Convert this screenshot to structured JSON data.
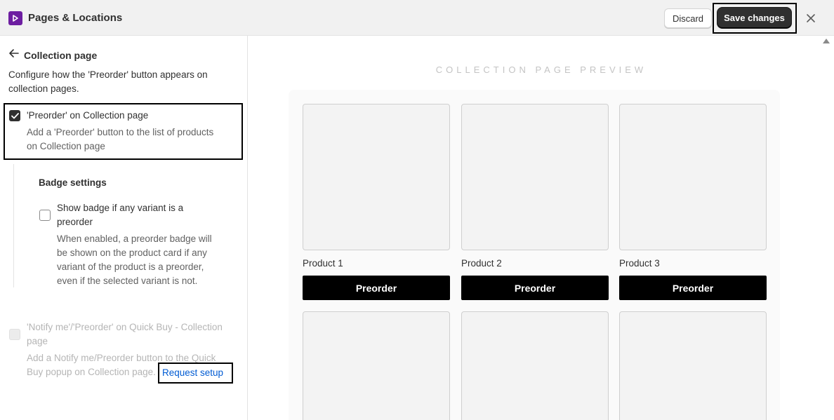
{
  "header": {
    "logo_icon": "app-logo-icon",
    "title": "Pages & Locations",
    "discard_label": "Discard",
    "save_label": "Save changes",
    "close_icon": "close-icon"
  },
  "sidebar": {
    "back_title": "Collection page",
    "description": "Configure how the 'Preorder' button appears on collection pages.",
    "option_preorder": {
      "checked": true,
      "label": "'Preorder' on Collection page",
      "help_line1": "Add a 'Preorder' button to the list of products",
      "help_line2": "on Collection page"
    },
    "badge_settings": {
      "heading": "Badge settings",
      "checked": false,
      "label_line1": "Show badge if any variant is a",
      "label_line2": "preorder",
      "help_line1": "When enabled, a preorder badge will",
      "help_line2": "be shown on the product card if any",
      "help_line3": "variant of the product is a preorder,",
      "help_line4": "even if the selected variant is not."
    },
    "option_quick_buy": {
      "disabled": true,
      "label_line1": "'Notify me'/'Preorder' on Quick Buy - Collection",
      "label_line2": "page",
      "help_line1": "Add a Notify me/Preorder button to the Quick",
      "help_line2": "Buy popup on Collection page.",
      "link_label": "Request setup"
    }
  },
  "preview": {
    "heading": "COLLECTION PAGE PREVIEW",
    "products": [
      {
        "name": "Product 1",
        "button_label": "Preorder"
      },
      {
        "name": "Product 2",
        "button_label": "Preorder"
      },
      {
        "name": "Product 3",
        "button_label": "Preorder"
      }
    ]
  },
  "colors": {
    "accent_purple": "#6d1ea1",
    "primary_button": "#303030",
    "link_blue": "#005bd3",
    "preorder_button": "#000000"
  }
}
